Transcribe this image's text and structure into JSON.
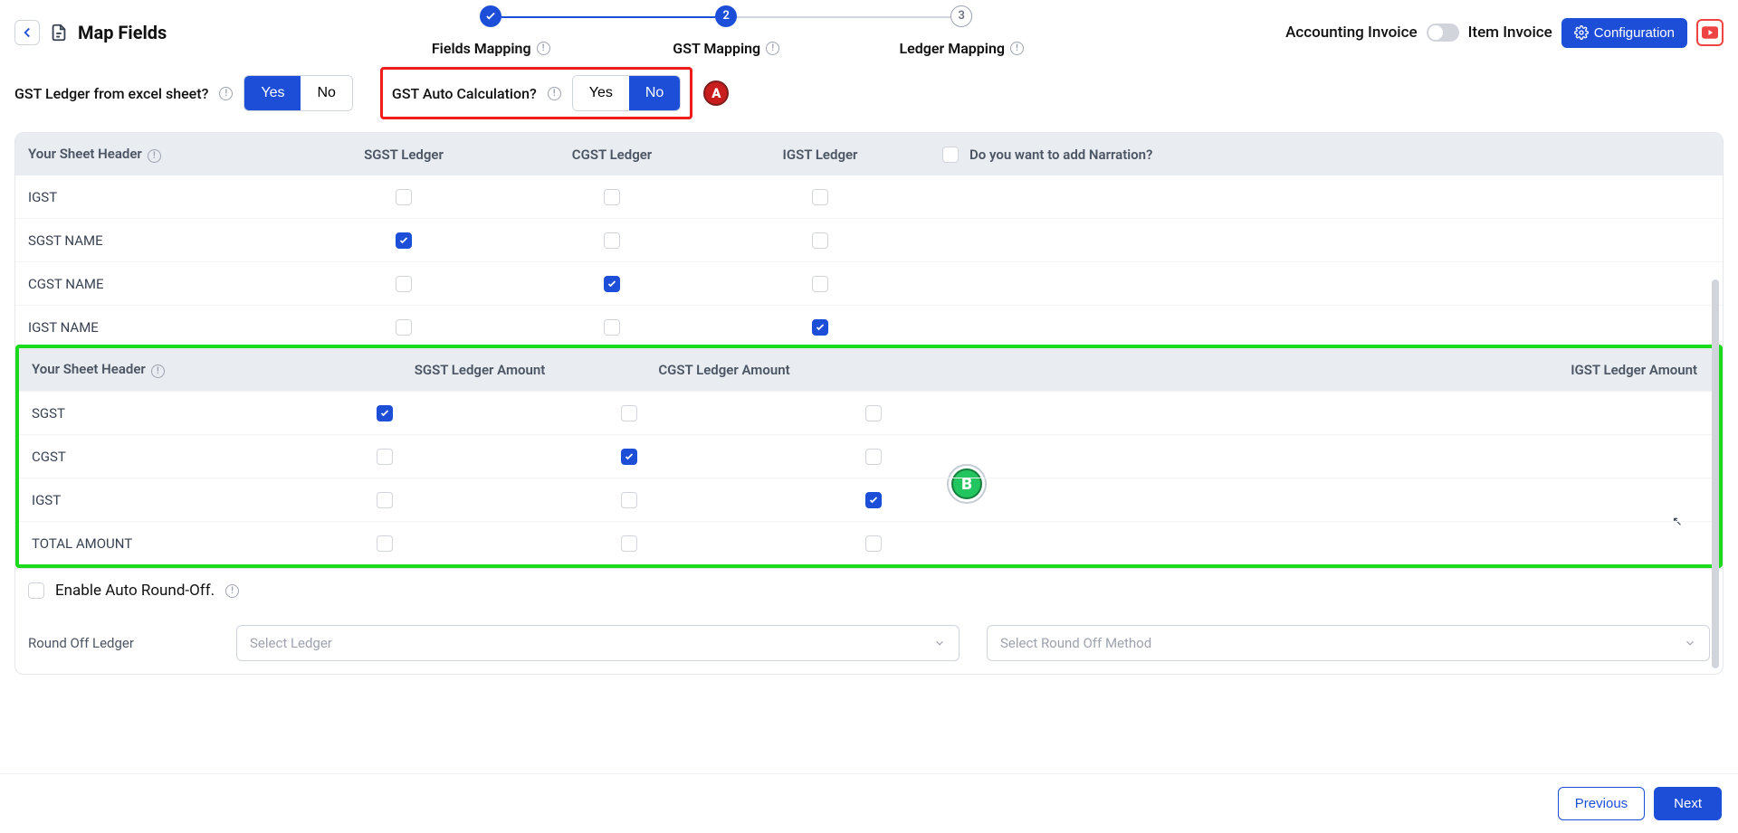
{
  "header": {
    "title": "Map Fields",
    "steps": [
      {
        "label": "Fields Mapping",
        "state": "done"
      },
      {
        "label": "GST Mapping",
        "state": "active",
        "num": "2"
      },
      {
        "label": "Ledger Mapping",
        "state": "pending",
        "num": "3"
      }
    ],
    "invoice_left": "Accounting Invoice",
    "invoice_right": "Item Invoice",
    "config_btn": "Configuration"
  },
  "options": {
    "q1": "GST Ledger from excel sheet?",
    "q2": "GST Auto Calculation?",
    "yes": "Yes",
    "no": "No",
    "q1_value": "Yes",
    "q2_value": "No"
  },
  "table1": {
    "headers": {
      "sheet": "Your Sheet Header",
      "sgst": "SGST Ledger",
      "cgst": "CGST Ledger",
      "igst": "IGST Ledger",
      "narr": "Do you want to add Narration?"
    },
    "rows": [
      {
        "name": "IGST",
        "sgst": false,
        "cgst": false,
        "igst": false
      },
      {
        "name": "SGST NAME",
        "sgst": true,
        "cgst": false,
        "igst": false
      },
      {
        "name": "CGST NAME",
        "sgst": false,
        "cgst": true,
        "igst": false
      },
      {
        "name": "IGST NAME",
        "sgst": false,
        "cgst": false,
        "igst": true
      }
    ]
  },
  "table2": {
    "headers": {
      "sheet": "Your Sheet Header",
      "sgst": "SGST Ledger Amount",
      "cgst": "CGST Ledger Amount",
      "igst": "IGST Ledger Amount"
    },
    "rows": [
      {
        "name": "SGST",
        "sgst": true,
        "cgst": false,
        "igst": false
      },
      {
        "name": "CGST",
        "sgst": false,
        "cgst": true,
        "igst": false
      },
      {
        "name": "IGST",
        "sgst": false,
        "cgst": false,
        "igst": true
      },
      {
        "name": "TOTAL AMOUNT",
        "sgst": false,
        "cgst": false,
        "igst": false
      }
    ]
  },
  "roundoff": {
    "enable": "Enable Auto Round-Off.",
    "ledger_label": "Round Off Ledger",
    "select_ledger": "Select Ledger",
    "select_method": "Select Round Off Method"
  },
  "footer": {
    "prev": "Previous",
    "next": "Next"
  },
  "annot": {
    "a": "A",
    "b": "B"
  }
}
